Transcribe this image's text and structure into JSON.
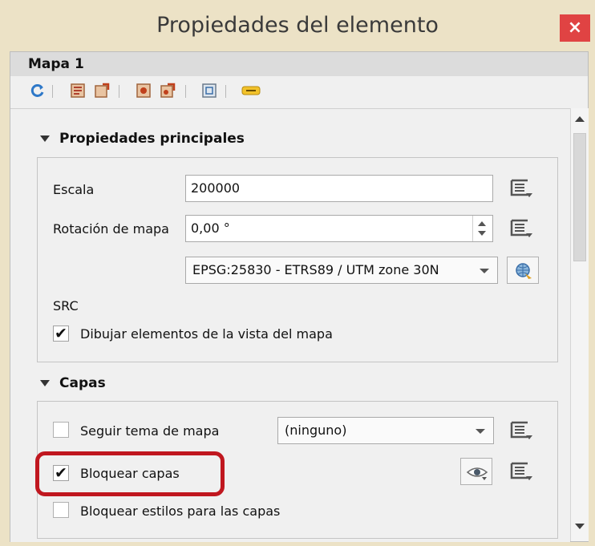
{
  "window": {
    "title": "Propiedades del elemento",
    "close_glyph": "×"
  },
  "item": {
    "name": "Mapa 1"
  },
  "toolbar": {
    "icons": [
      "refresh-icon",
      "map-extent-icon",
      "set-extent-icon",
      "atlas-icon",
      "atlas-set-icon",
      "view-extent-icon",
      "label-icon"
    ]
  },
  "main_props": {
    "header": "Propiedades principales",
    "scale_label": "Escala",
    "scale_value": "200000",
    "rotation_label": "Rotación de mapa",
    "rotation_value": "0,00 °",
    "crs_value": "EPSG:25830 - ETRS89 / UTM zone 30N",
    "crs_label": "SRC",
    "draw_items_check": "✔",
    "draw_items_label": "Dibujar elementos de la vista del mapa"
  },
  "layers": {
    "header": "Capas",
    "follow_theme_label": "Seguir tema de mapa",
    "theme_value": "(ninguno)",
    "lock_layers_check": "✔",
    "lock_layers_label": "Bloquear capas",
    "lock_styles_label": "Bloquear estilos para las capas"
  },
  "colors": {
    "title_bg": "#ece2c6",
    "close_bg": "#e04343",
    "highlight": "#c0171f"
  }
}
